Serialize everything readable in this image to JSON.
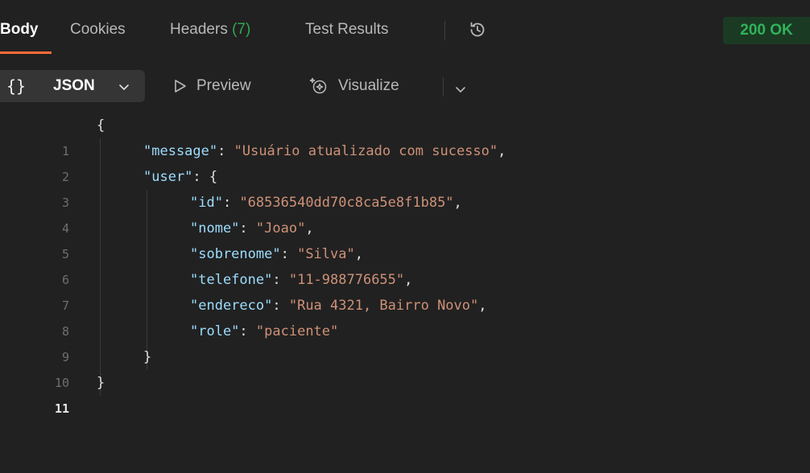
{
  "tabs": [
    {
      "label": "Body",
      "active": true
    },
    {
      "label": "Cookies",
      "active": false
    },
    {
      "label": "Headers",
      "count": "(7)",
      "active": false
    },
    {
      "label": "Test Results",
      "active": false
    }
  ],
  "status": "200 OK",
  "toolbar": {
    "format_braces": "{}",
    "format_label": "JSON",
    "preview_label": "Preview",
    "visualize_label": "Visualize"
  },
  "icons": {
    "history": "history-icon",
    "chevron": "chevron-down-icon",
    "preview": "play-icon",
    "visualize": "sparkle-icon"
  },
  "colors": {
    "accent": "#ff6c37",
    "status_green": "#2fb35a",
    "json_key": "#9cdcfe",
    "json_string": "#ce9178"
  },
  "code": {
    "line_numbers": [
      "1",
      "2",
      "3",
      "4",
      "5",
      "6",
      "7",
      "8",
      "9",
      "10",
      "11"
    ],
    "l1": "{",
    "l2_key": "\"message\"",
    "l2_val": "\"Usuário atualizado com sucesso\"",
    "l3_key": "\"user\"",
    "l3_open": "{",
    "l4_key": "\"id\"",
    "l4_val": "\"68536540dd70c8ca5e8f1b85\"",
    "l5_key": "\"nome\"",
    "l5_val": "\"Joao\"",
    "l6_key": "\"sobrenome\"",
    "l6_val": "\"Silva\"",
    "l7_key": "\"telefone\"",
    "l7_val": "\"11-988776655\"",
    "l8_key": "\"endereco\"",
    "l8_val": "\"Rua 4321, Bairro Novo\"",
    "l9_key": "\"role\"",
    "l9_val": "\"paciente\"",
    "l10": "}",
    "l11": "}",
    "colon": ": ",
    "comma": ","
  }
}
